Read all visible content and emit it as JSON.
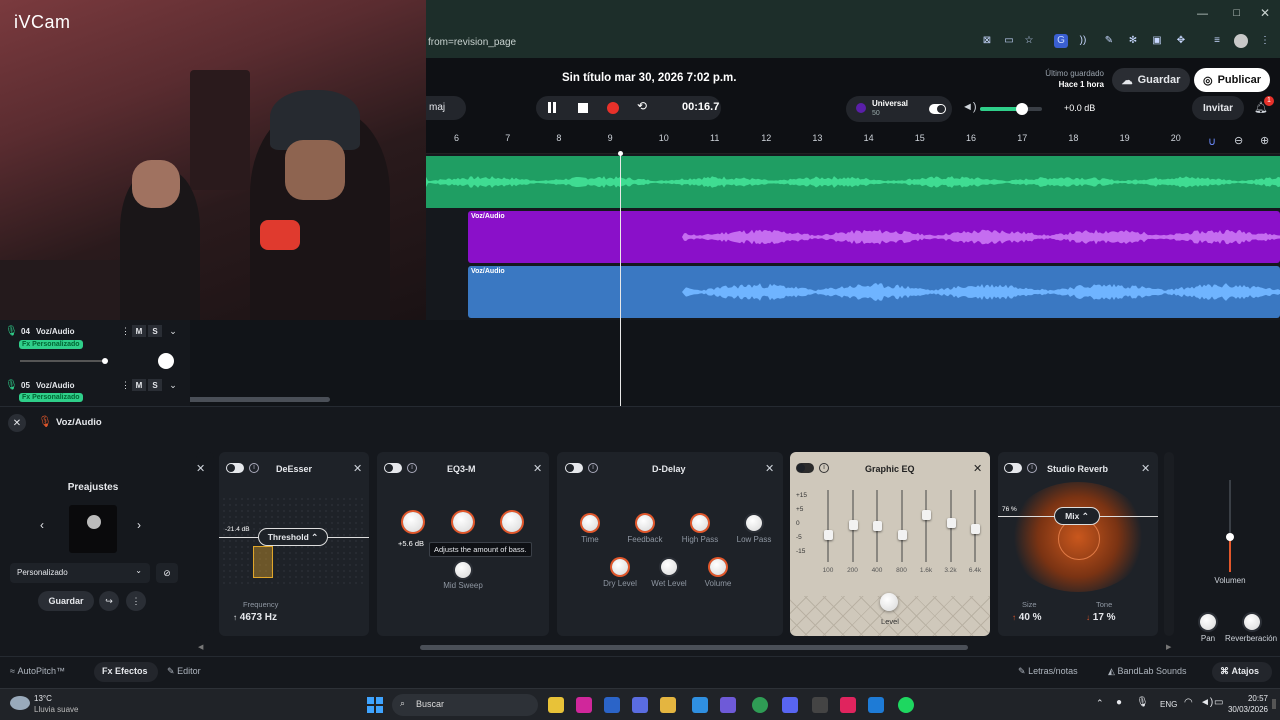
{
  "webcam": {
    "logo": "iVCam"
  },
  "browser": {
    "url": "from=revision_page"
  },
  "project": {
    "title": "Sin título mar 30, 2026 7:02 p.m.",
    "saved_label": "Último guardado",
    "saved_time": "Hace 1 hora",
    "save_btn": "Guardar",
    "publish_btn": "Publicar",
    "invite_btn": "Invitar",
    "notif_count": "1",
    "key_label": "maj",
    "time": "00:16.7",
    "tuner_name": "Universal",
    "tuner_value": "50",
    "volume_db": "+0.0 dB"
  },
  "ruler": [
    "6",
    "7",
    "8",
    "9",
    "10",
    "11",
    "12",
    "13",
    "14",
    "15",
    "16",
    "17",
    "18",
    "19",
    "20"
  ],
  "tracks": [
    {
      "num": "04",
      "name": "Voz/Audio",
      "fx": "Fx Personalizado",
      "m": "M",
      "s": "S",
      "clip": "Voz/Audio",
      "color": "#8a10c9"
    },
    {
      "num": "05",
      "name": "Voz/Audio",
      "fx": "Fx Personalizado",
      "m": "M",
      "s": "S",
      "clip": "Voz/Audio",
      "color": "#3a78c2"
    }
  ],
  "panel": {
    "track_name": "Voz/Audio"
  },
  "presets": {
    "title": "Preajustes",
    "selected": "Personalizado",
    "save": "Guardar"
  },
  "fx": {
    "deesser": {
      "title": "DeEsser",
      "threshold_btn": "Threshold",
      "db": "-21.4 dB",
      "freq_label": "Frequency",
      "freq_value": "4673 Hz"
    },
    "eq3": {
      "title": "EQ3-M",
      "value": "+5.6 dB",
      "tooltip": "Adjusts the amount of bass.",
      "mid_sweep": "Mid Sweep"
    },
    "delay": {
      "title": "D-Delay",
      "time": "Time",
      "feedback": "Feedback",
      "highpass": "High Pass",
      "lowpass": "Low Pass",
      "dry": "Dry Level",
      "wet": "Wet Level",
      "volume": "Volume"
    },
    "geq": {
      "title": "Graphic EQ",
      "scale": [
        "+15",
        "+5",
        "0",
        "-5",
        "-15"
      ],
      "bands": [
        "100",
        "200",
        "400",
        "800",
        "1.6k",
        "3.2k",
        "6.4k"
      ],
      "levels": [
        0.35,
        0.52,
        0.5,
        0.36,
        0.68,
        0.55,
        0.45
      ],
      "level_label": "Level"
    },
    "reverb": {
      "title": "Studio Reverb",
      "mix_btn": "Mix",
      "mix_pct": "76 %",
      "size_label": "Size",
      "size_value": "40 %",
      "tone_label": "Tone",
      "tone_value": "17 %"
    }
  },
  "right": {
    "volumen": "Volumen",
    "pan": "Pan",
    "reverb": "Reverberación"
  },
  "bottom": {
    "autopitch": "AutoPitch™",
    "efectos": "Efectos",
    "editor": "Editor",
    "letras": "Letras/notas",
    "sounds": "BandLab Sounds",
    "atajos": "Atajos"
  },
  "taskbar": {
    "temp": "13°C",
    "weather": "Lluvia suave",
    "search": "Buscar",
    "lang": "ENG",
    "time": "20:57",
    "date": "30/03/2026"
  }
}
